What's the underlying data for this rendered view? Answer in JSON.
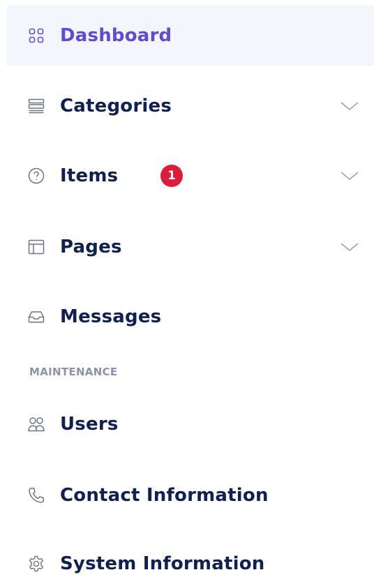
{
  "sidebar": {
    "items": [
      {
        "label": "Dashboard",
        "icon": "dashboard-grid-icon",
        "active": true
      },
      {
        "label": "Categories",
        "icon": "categories-list-icon",
        "expandable": true
      },
      {
        "label": "Items",
        "icon": "help-circle-icon",
        "expandable": true,
        "badge": "1"
      },
      {
        "label": "Pages",
        "icon": "layout-icon",
        "expandable": true
      },
      {
        "label": "Messages",
        "icon": "inbox-icon"
      }
    ],
    "maintenance": {
      "heading": "MAINTENANCE",
      "items": [
        {
          "label": "Users",
          "icon": "users-icon"
        },
        {
          "label": "Contact Information",
          "icon": "phone-icon"
        },
        {
          "label": "System Information",
          "icon": "gear-icon"
        }
      ]
    }
  },
  "colors": {
    "active_text": "#5f4bd8",
    "text": "#0f2152",
    "badge": "#dc1c3a",
    "active_bg": "#f4f6fd",
    "muted": "#8a93a9"
  }
}
